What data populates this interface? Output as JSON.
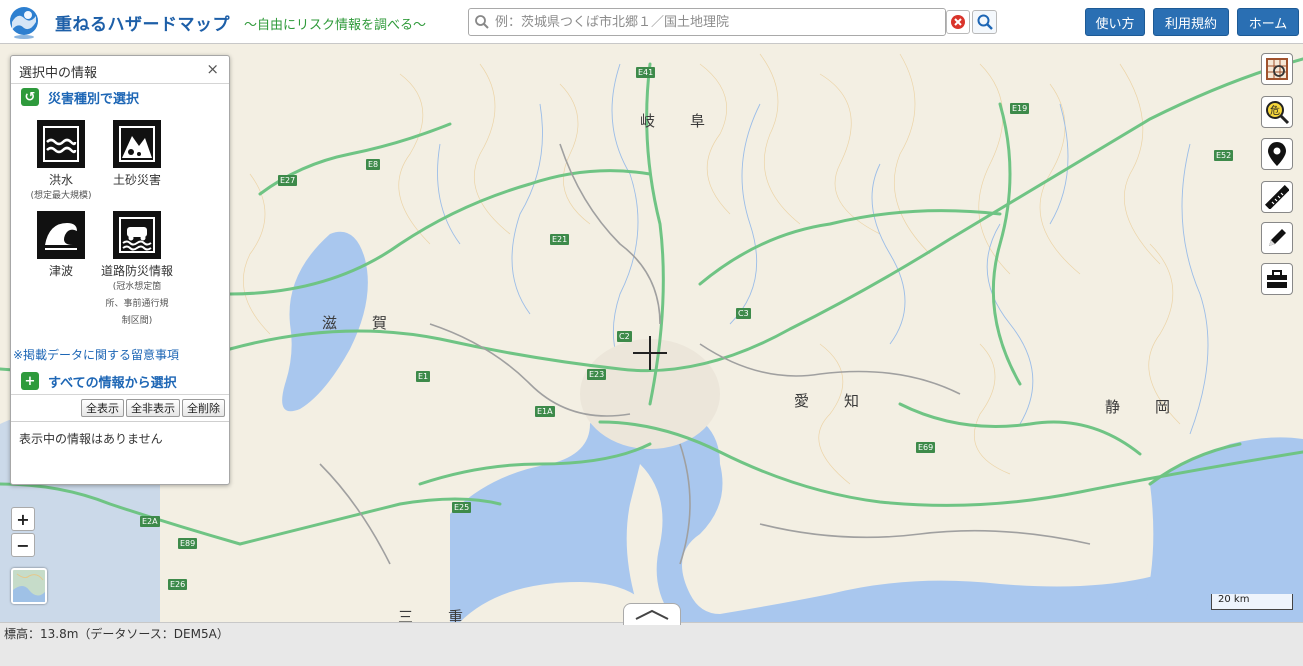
{
  "header": {
    "app_title": "重ねるハザードマップ",
    "subtitle": "～自由にリスク情報を調べる～",
    "search_placeholder": "例：茨城県つくば市北郷１／国土地理院",
    "buttons": [
      {
        "label": "使い方"
      },
      {
        "label": "利用規約"
      },
      {
        "label": "ホーム"
      }
    ],
    "icons": {
      "logo": "globe-logo-icon",
      "search": "search-icon",
      "clear": "clear-icon",
      "go": "go-search-icon"
    }
  },
  "panel": {
    "title": "選択中の情報",
    "close": "×",
    "section_disaster": "災害種別で選択",
    "hazards": [
      {
        "label": "洪水",
        "note": "(想定最大規模)",
        "icon": "flood-icon"
      },
      {
        "label": "土砂災害",
        "note": "",
        "icon": "landslide-icon"
      },
      {
        "label": "津波",
        "note": "",
        "icon": "tsunami-icon"
      },
      {
        "label": "道路防災情報",
        "note_lines": [
          "(冠水想定箇",
          "所、事前通行規",
          "制区間)"
        ],
        "icon": "road-disaster-icon"
      }
    ],
    "notice_link": "※掲載データに関する留意事項",
    "section_all": "すべての情報から選択",
    "buttons": {
      "show_all": "全表示",
      "hide_all": "全非表示",
      "delete_all": "全削除"
    },
    "empty_message": "表示中の情報はありません"
  },
  "map": {
    "zoom_in": "+",
    "zoom_out": "−",
    "scale": "20 km",
    "places": {
      "gifu": "岐　阜",
      "shiga": "滋　賀",
      "aichi": "愛　知",
      "shizuoka": "静　岡",
      "mie": "三　重"
    },
    "roads": [
      "E41",
      "E19",
      "E8",
      "E27",
      "E21",
      "E1",
      "E1A",
      "E23",
      "E25",
      "E26",
      "E2A",
      "E69",
      "E52",
      "C2",
      "C3",
      "E89"
    ],
    "right_tools": [
      "layers-grid-icon",
      "hazard-search-icon",
      "location-pin-icon",
      "ruler-icon",
      "pencil-icon",
      "toolbox-icon"
    ],
    "colors": {
      "water": "#a9c7ee",
      "expressway": "#6fc484",
      "land": "#f3efe3"
    }
  },
  "footer": {
    "elevation": "標高：13.8m（データソース：DEM5A）"
  }
}
